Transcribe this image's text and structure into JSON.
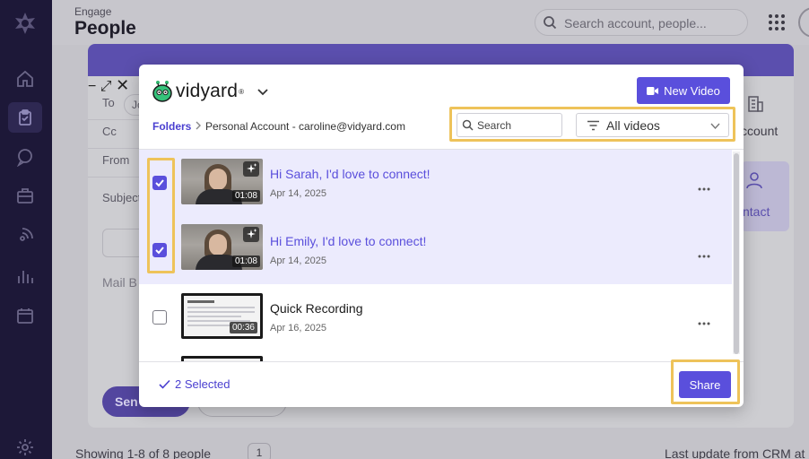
{
  "app": {
    "breadcrumb": "Engage",
    "page_title": "People",
    "search_placeholder": "Search account, people...",
    "footer_left": "Showing 1-8 of 8 people",
    "pager_current": "1",
    "footer_right": "Last update from CRM at"
  },
  "composer": {
    "to_label": "To",
    "cc_label": "Cc",
    "from_label": "From",
    "subject_label": "Subject",
    "to_chip": "Jo",
    "body_placeholder": "Mail B",
    "send_label": "Sen",
    "account_label": "ccount",
    "contact_label": "ntact"
  },
  "modal": {
    "brand": "vidyard",
    "new_video_label": "New Video",
    "breadcrumb_root": "Folders",
    "breadcrumb_current": "Personal Account - caroline@vidyard.com",
    "search_placeholder": "Search",
    "filter_value": "All videos",
    "videos": [
      {
        "title": "Hi Sarah, I'd love to connect!",
        "date": "Apr 14, 2025",
        "duration": "01:08",
        "checked": true
      },
      {
        "title": "Hi Emily, I'd love to connect!",
        "date": "Apr 14, 2025",
        "duration": "01:08",
        "checked": true
      },
      {
        "title": "Quick Recording",
        "date": "Apr 16, 2025",
        "duration": "00:36",
        "checked": false
      }
    ],
    "selected_count": "2 Selected",
    "share_label": "Share"
  },
  "colors": {
    "accent": "#5a4fdc",
    "highlight": "#eec35a",
    "selected_row": "#ecebfd",
    "rail": "#1d1838"
  },
  "icons": [
    "home-icon",
    "clipboard-icon",
    "chat-icon",
    "briefcase-icon",
    "signal-icon",
    "chart-icon",
    "calendar-icon",
    "settings-icon",
    "search-icon",
    "grid-icon",
    "video-camera-icon",
    "filter-icon",
    "chevron-down-icon",
    "sparkle-icon",
    "kebab-icon",
    "check-icon"
  ]
}
